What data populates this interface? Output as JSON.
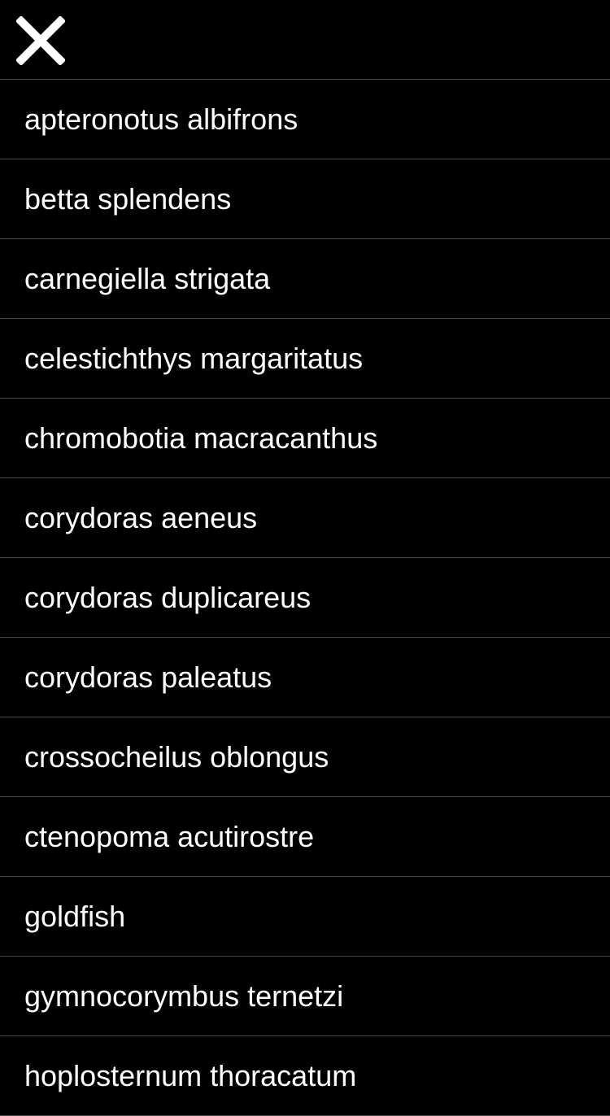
{
  "header": {
    "close_icon": "close-x-icon"
  },
  "colors": {
    "background": "#000000",
    "text": "#ffffff",
    "divider": "#4a4a4a"
  },
  "species_list": {
    "items": [
      {
        "label": "apteronotus albifrons"
      },
      {
        "label": "betta splendens"
      },
      {
        "label": "carnegiella strigata"
      },
      {
        "label": "celestichthys margaritatus"
      },
      {
        "label": "chromobotia macracanthus"
      },
      {
        "label": "corydoras aeneus"
      },
      {
        "label": "corydoras duplicareus"
      },
      {
        "label": "corydoras paleatus"
      },
      {
        "label": "crossocheilus oblongus"
      },
      {
        "label": "ctenopoma acutirostre"
      },
      {
        "label": "goldfish"
      },
      {
        "label": "gymnocorymbus ternetzi"
      },
      {
        "label": "hoplosternum thoracatum"
      }
    ]
  }
}
